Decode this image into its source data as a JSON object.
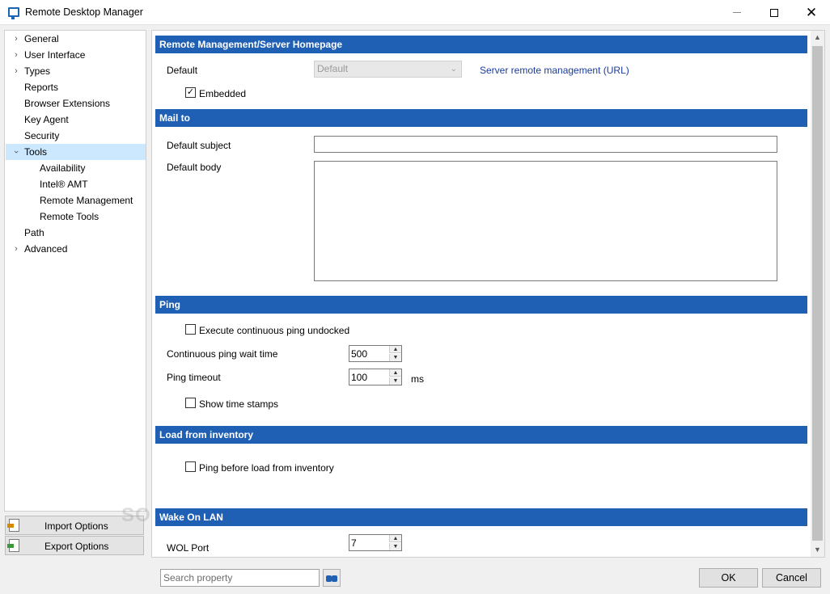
{
  "window": {
    "title": "Remote Desktop Manager"
  },
  "tree": {
    "items": [
      {
        "label": "General",
        "expandable": true
      },
      {
        "label": "User Interface",
        "expandable": true
      },
      {
        "label": "Types",
        "expandable": true
      },
      {
        "label": "Reports",
        "expandable": false
      },
      {
        "label": "Browser Extensions",
        "expandable": false
      },
      {
        "label": "Key Agent",
        "expandable": false
      },
      {
        "label": "Security",
        "expandable": false
      },
      {
        "label": "Tools",
        "expandable": true,
        "expanded": true,
        "selected": true
      },
      {
        "label": "Availability",
        "child": true
      },
      {
        "label": "Intel® AMT",
        "child": true
      },
      {
        "label": "Remote Management",
        "child": true
      },
      {
        "label": "Remote Tools",
        "child": true
      },
      {
        "label": "Path",
        "expandable": false
      },
      {
        "label": "Advanced",
        "expandable": true
      }
    ]
  },
  "options": {
    "import_label": "Import Options",
    "export_label": "Export Options"
  },
  "remote_management": {
    "header": "Remote Management/Server Homepage",
    "default_label": "Default",
    "default_value": "Default",
    "link": "Server remote management (URL)",
    "embedded_label": "Embedded",
    "embedded_checked": true
  },
  "mail_to": {
    "header": "Mail to",
    "subject_label": "Default subject",
    "subject_value": "",
    "body_label": "Default body",
    "body_value": ""
  },
  "ping": {
    "header": "Ping",
    "continuous_label": "Execute continuous ping undocked",
    "continuous_checked": false,
    "wait_label": "Continuous ping wait time",
    "wait_value": "500",
    "timeout_label": "Ping timeout",
    "timeout_value": "100",
    "timeout_unit": "ms",
    "timestamps_label": "Show time stamps",
    "timestamps_checked": false
  },
  "inventory": {
    "header": "Load from inventory",
    "ping_label": "Ping before load from inventory",
    "ping_checked": false
  },
  "wol": {
    "header": "Wake On LAN",
    "port_label": "WOL Port",
    "port_value": "7"
  },
  "footer": {
    "search_placeholder": "Search property",
    "ok_label": "OK",
    "cancel_label": "Cancel"
  },
  "watermark": "SOFTPEDIA",
  "colors": {
    "section_header": "#1f5fb4",
    "selection": "#cce8ff",
    "link": "#1a3c9c"
  }
}
